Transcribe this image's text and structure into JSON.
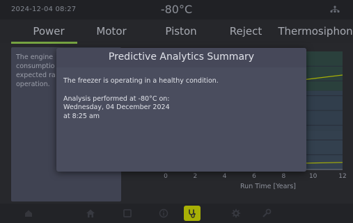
{
  "status": {
    "datetime": "2024-12-04  08:27",
    "temperature": "-80°C",
    "network_icon": "network-icon"
  },
  "tabs": [
    {
      "label": "Power",
      "active": true
    },
    {
      "label": "Motor",
      "active": false
    },
    {
      "label": "Piston",
      "active": false
    },
    {
      "label": "Reject",
      "active": false
    },
    {
      "label": "Thermosiphon",
      "active": false
    }
  ],
  "description": {
    "lines": [
      "The engine",
      "consumptio",
      "expected ra",
      "operation."
    ]
  },
  "modal": {
    "title": "Predictive Analytics Summary",
    "message": "The freezer is operating in a healthy condition.",
    "analysis_line1": "Analysis performed at -80°C on:",
    "analysis_line2": "Wednesday, 04 December 2024",
    "analysis_line3": "at  8:25 am"
  },
  "chart_data": {
    "type": "area",
    "xlabel": "Run Time [Years]",
    "x_ticks": [
      0,
      2,
      4,
      6,
      8,
      10,
      12
    ],
    "y_ticks_visible": [
      "0"
    ],
    "xlim": [
      0,
      12
    ],
    "series": [
      {
        "color": "#c8d200",
        "x": [
          0,
          12
        ],
        "y": [
          0.62,
          0.8
        ]
      },
      {
        "color": "#c8d200",
        "x": [
          0,
          12
        ],
        "y": [
          0.03,
          0.06
        ]
      }
    ],
    "bands": [
      "#2f4a44",
      "#374757",
      "#3a4a5a"
    ]
  },
  "colors": {
    "accent": "#8bc34a",
    "highlight": "#c8d200",
    "panel": "#4a4d5e"
  },
  "nav": [
    {
      "icon": "home-icon",
      "active": false
    },
    {
      "icon": "home-icon",
      "active": false
    },
    {
      "icon": "square-icon",
      "active": false
    },
    {
      "icon": "info-icon",
      "active": false
    },
    {
      "icon": "stethoscope-icon",
      "active": true
    },
    {
      "icon": "gear-icon",
      "active": false
    },
    {
      "icon": "wrench-icon",
      "active": false
    }
  ]
}
